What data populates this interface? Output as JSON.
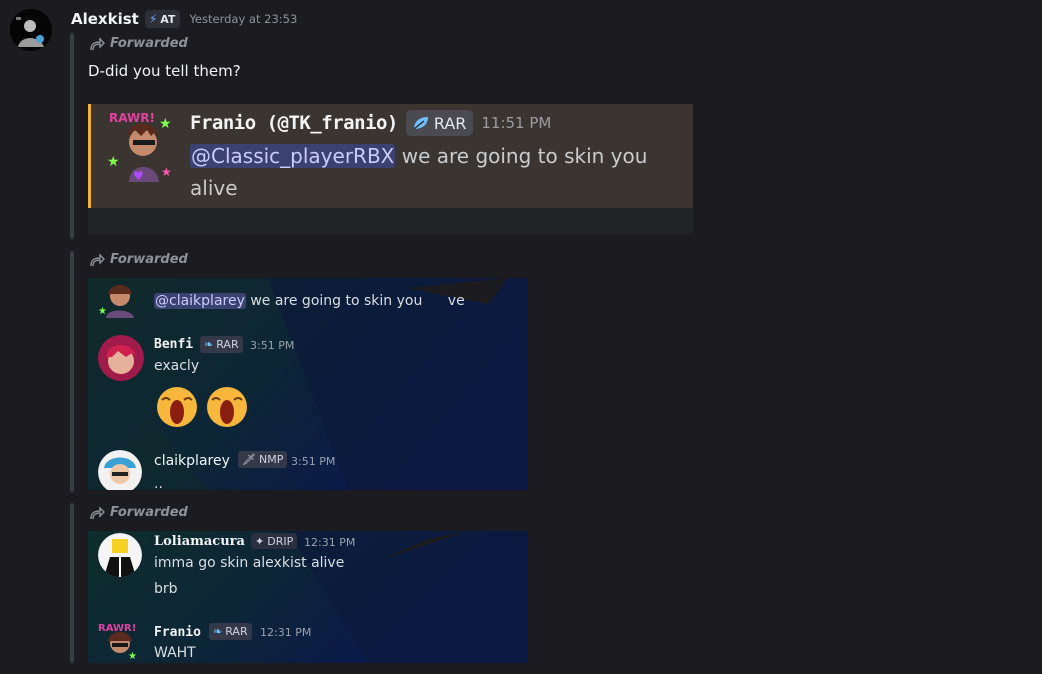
{
  "message": {
    "author": "Alexkist",
    "tag": "AT",
    "timestamp": "Yesterday at 23:53"
  },
  "forward_label": "Forwarded",
  "forward1": {
    "text": "D-did you tell them?",
    "embed": {
      "author": "Franio (@TK_franio)",
      "tag": "RAR",
      "time": "11:51 PM",
      "mention": "@Classic_playerRBX",
      "text": " we are going to skin you alive"
    }
  },
  "forward2": {
    "mention": "@claikplarey",
    "top_text": " we are going to skin you",
    "top_text_tail": "ve",
    "msg1": {
      "author": "Benfi",
      "tag": "RAR",
      "time": "3:51 PM",
      "text": "exacly",
      "emoji": [
        "crying-emoji",
        "crying-emoji"
      ]
    },
    "msg2": {
      "author": "claikplarey",
      "tag": "NMP",
      "time": "3:51 PM",
      "text": ".."
    }
  },
  "forward3": {
    "msg1": {
      "author": "Loliamacura",
      "tag": "DRIP",
      "time": "12:31 PM",
      "lines": [
        "imma go skin alexkist alive",
        "brb"
      ]
    },
    "msg2": {
      "author": "Franio",
      "tag": "RAR",
      "time": "12:31 PM",
      "text": "WAHT"
    }
  },
  "colors": {
    "background": "#1c1c20",
    "embed_accent": "#f0b232",
    "mention_bg": "#3c4270"
  }
}
